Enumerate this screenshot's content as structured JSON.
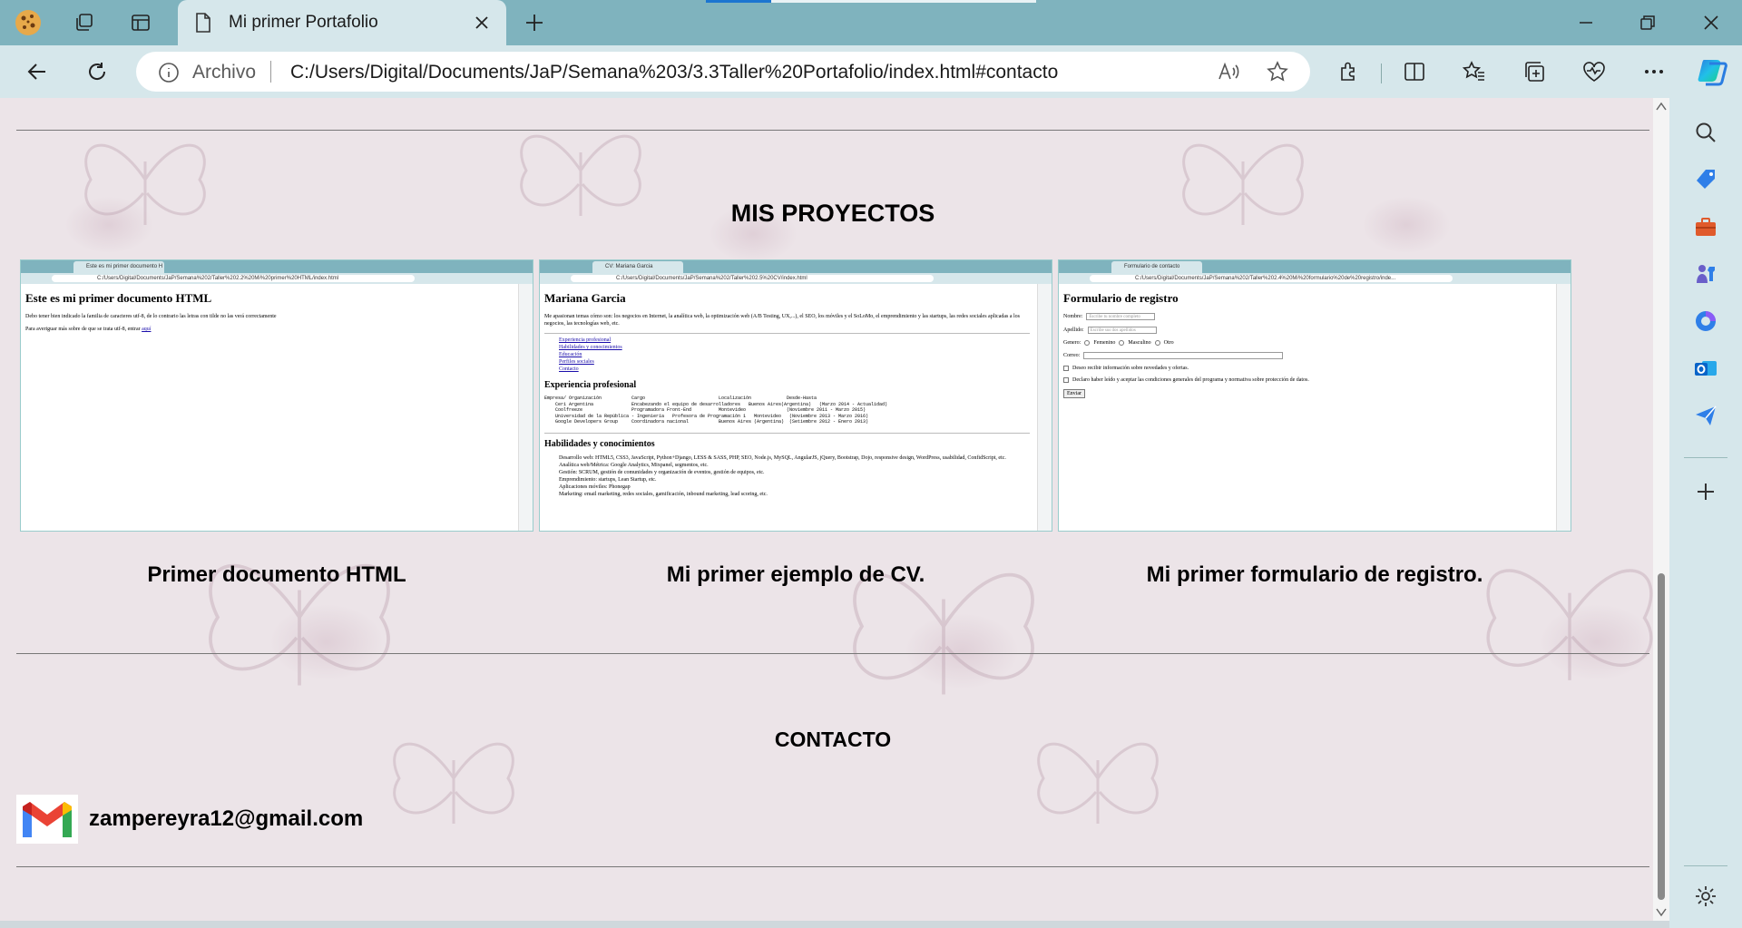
{
  "browser": {
    "tab": {
      "title": "Mi primer Portafolio",
      "doc_icon": "document-icon",
      "close_icon": "close-icon"
    },
    "new_tab_icon": "plus-icon",
    "address": {
      "security_label": "Archivo",
      "url": "C:/Users/Digital/Documents/JaP/Semana%203/3.3Taller%20Portafolio/index.html#contacto"
    },
    "accent": "#7fb3be",
    "toolbar_bg": "#d6e7eb"
  },
  "page": {
    "projects_title": "MIS PROYECTOS",
    "projects": [
      {
        "caption": "Primer documento HTML",
        "shot": {
          "tab": "Este es mi primer documento H",
          "url": "C:/Users/Digital/Documents/JaP/Semana%202/Taller%202.2%20Mi%20primer%20HTML/index.html",
          "heading": "Este es mi primer documento HTML",
          "p1": "Debo tener bien indicado la familia de caracteres utf-8, de lo contrario las letras con tilde no las verá correctamente",
          "p2": "Para averiguar más sobre de que se trata utf-8, entrar",
          "link": "aquí"
        }
      },
      {
        "caption": "Mi primer ejemplo de CV.",
        "shot": {
          "tab": "CV: Mariana Garcia",
          "url": "C:/Users/Digital/Documents/JaP/Semana%202/Taller%202.5%20CV/index.html",
          "heading": "Mariana Garcia",
          "intro": "Me apasionan temas cómo son: los negocios en Internet, la analítica web, la optimización web (A/B Testing, UX,...), el SEO, los móviles y el SoLoMo, el emprendimiento y las startups, las redes sociales aplicadas a los negocios, las tecnologías web, etc.",
          "nav": [
            "Experiencia profesional",
            "Habilidades y conocimientos",
            "Educación",
            "Perfiles sociales",
            "Contacto"
          ],
          "exp_title": "Experiencia profesional",
          "exp_table": "Empresa/ Organización           Cargo                           Localización             Desde-Hasta\n    Ceri Argentina              Encabezando el equipo de desarrolladores   Buenos Aires(Argentina)   (Marzo 2014 - Actualidad)\n    Coolfreeze                  Programadora Front-End          Montevideo               (Noviembre 2011 - Marzo 2015)\n    Universidad de la República - Ingeniería   Profesora de Programación 1   Montevideo   (Noviembre 2013 - Marzo 2016)\n    Google Developers Group     Coordinadora nacional           Buenos Aires (Argentina)  (Setiembre 2012 - Enero 2013)",
          "skills_title": "Habilidades y conocimientos",
          "skills": [
            "Desarrollo web: HTML5, CSS3, JavaScript, Python+Django, LESS & SASS, PHP, SEO, Node.js, MySQL, AngularJS, jQuery, Bootstrap, Dojo, responsive design, WordPress, usabilidad, ConfidScript, etc.",
            "Analítica web/Métrica: Google Analytics, Mixpanel, segmentos, etc.",
            "Gestión: SCRUM, gestión de comunidades y organización de eventos, gestión de equipos, etc.",
            "Emprendimiento: startups, Lean Startup, etc.",
            "Aplicaciones móviles: Phonegap",
            "Marketing: email marketing, redes sociales, gamificación, inbound marketing, lead scoring, etc."
          ]
        }
      },
      {
        "caption": "Mi primer formulario de registro.",
        "shot": {
          "tab": "Formulario de contacto",
          "url": "C:/Users/Digital/Documents/JaP/Semana%202/Taller%202.4%20Mi%20formulario%20de%20registro/inde...",
          "heading": "Formulario de registro",
          "nombre_label": "Nombre:",
          "nombre_ph": "Escribe tu nombre completo",
          "apellido_label": "Apellido:",
          "apellido_ph": "Escribe sus dos apellidos",
          "genero_label": "Genero:",
          "genero_opts": [
            "Femenino",
            "Masculino",
            "Otro"
          ],
          "correo_label": "Correo:",
          "cb1": "Deseo recibir información sobre novedades y ofertas.",
          "cb2": "Declaro haber leído y aceptar las condiciones generales del programa y normativa sobre protección de datos.",
          "submit": "Enviar"
        }
      }
    ],
    "contact_title": "CONTACTO",
    "email": "zampereyra12@gmail.com",
    "email_icon": "gmail-icon"
  }
}
